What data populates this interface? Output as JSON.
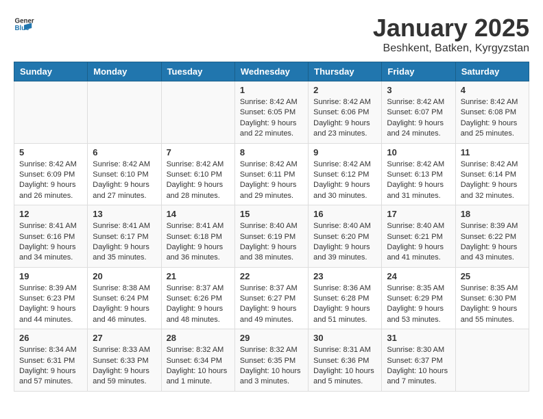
{
  "header": {
    "logo_general": "General",
    "logo_blue": "Blue",
    "month_title": "January 2025",
    "location": "Beshkent, Batken, Kyrgyzstan"
  },
  "days_of_week": [
    "Sunday",
    "Monday",
    "Tuesday",
    "Wednesday",
    "Thursday",
    "Friday",
    "Saturday"
  ],
  "weeks": [
    {
      "days": [
        {
          "num": "",
          "info": ""
        },
        {
          "num": "",
          "info": ""
        },
        {
          "num": "",
          "info": ""
        },
        {
          "num": "1",
          "info": "Sunrise: 8:42 AM\nSunset: 6:05 PM\nDaylight: 9 hours\nand 22 minutes."
        },
        {
          "num": "2",
          "info": "Sunrise: 8:42 AM\nSunset: 6:06 PM\nDaylight: 9 hours\nand 23 minutes."
        },
        {
          "num": "3",
          "info": "Sunrise: 8:42 AM\nSunset: 6:07 PM\nDaylight: 9 hours\nand 24 minutes."
        },
        {
          "num": "4",
          "info": "Sunrise: 8:42 AM\nSunset: 6:08 PM\nDaylight: 9 hours\nand 25 minutes."
        }
      ]
    },
    {
      "days": [
        {
          "num": "5",
          "info": "Sunrise: 8:42 AM\nSunset: 6:09 PM\nDaylight: 9 hours\nand 26 minutes."
        },
        {
          "num": "6",
          "info": "Sunrise: 8:42 AM\nSunset: 6:10 PM\nDaylight: 9 hours\nand 27 minutes."
        },
        {
          "num": "7",
          "info": "Sunrise: 8:42 AM\nSunset: 6:10 PM\nDaylight: 9 hours\nand 28 minutes."
        },
        {
          "num": "8",
          "info": "Sunrise: 8:42 AM\nSunset: 6:11 PM\nDaylight: 9 hours\nand 29 minutes."
        },
        {
          "num": "9",
          "info": "Sunrise: 8:42 AM\nSunset: 6:12 PM\nDaylight: 9 hours\nand 30 minutes."
        },
        {
          "num": "10",
          "info": "Sunrise: 8:42 AM\nSunset: 6:13 PM\nDaylight: 9 hours\nand 31 minutes."
        },
        {
          "num": "11",
          "info": "Sunrise: 8:42 AM\nSunset: 6:14 PM\nDaylight: 9 hours\nand 32 minutes."
        }
      ]
    },
    {
      "days": [
        {
          "num": "12",
          "info": "Sunrise: 8:41 AM\nSunset: 6:16 PM\nDaylight: 9 hours\nand 34 minutes."
        },
        {
          "num": "13",
          "info": "Sunrise: 8:41 AM\nSunset: 6:17 PM\nDaylight: 9 hours\nand 35 minutes."
        },
        {
          "num": "14",
          "info": "Sunrise: 8:41 AM\nSunset: 6:18 PM\nDaylight: 9 hours\nand 36 minutes."
        },
        {
          "num": "15",
          "info": "Sunrise: 8:40 AM\nSunset: 6:19 PM\nDaylight: 9 hours\nand 38 minutes."
        },
        {
          "num": "16",
          "info": "Sunrise: 8:40 AM\nSunset: 6:20 PM\nDaylight: 9 hours\nand 39 minutes."
        },
        {
          "num": "17",
          "info": "Sunrise: 8:40 AM\nSunset: 6:21 PM\nDaylight: 9 hours\nand 41 minutes."
        },
        {
          "num": "18",
          "info": "Sunrise: 8:39 AM\nSunset: 6:22 PM\nDaylight: 9 hours\nand 43 minutes."
        }
      ]
    },
    {
      "days": [
        {
          "num": "19",
          "info": "Sunrise: 8:39 AM\nSunset: 6:23 PM\nDaylight: 9 hours\nand 44 minutes."
        },
        {
          "num": "20",
          "info": "Sunrise: 8:38 AM\nSunset: 6:24 PM\nDaylight: 9 hours\nand 46 minutes."
        },
        {
          "num": "21",
          "info": "Sunrise: 8:37 AM\nSunset: 6:26 PM\nDaylight: 9 hours\nand 48 minutes."
        },
        {
          "num": "22",
          "info": "Sunrise: 8:37 AM\nSunset: 6:27 PM\nDaylight: 9 hours\nand 49 minutes."
        },
        {
          "num": "23",
          "info": "Sunrise: 8:36 AM\nSunset: 6:28 PM\nDaylight: 9 hours\nand 51 minutes."
        },
        {
          "num": "24",
          "info": "Sunrise: 8:35 AM\nSunset: 6:29 PM\nDaylight: 9 hours\nand 53 minutes."
        },
        {
          "num": "25",
          "info": "Sunrise: 8:35 AM\nSunset: 6:30 PM\nDaylight: 9 hours\nand 55 minutes."
        }
      ]
    },
    {
      "days": [
        {
          "num": "26",
          "info": "Sunrise: 8:34 AM\nSunset: 6:31 PM\nDaylight: 9 hours\nand 57 minutes."
        },
        {
          "num": "27",
          "info": "Sunrise: 8:33 AM\nSunset: 6:33 PM\nDaylight: 9 hours\nand 59 minutes."
        },
        {
          "num": "28",
          "info": "Sunrise: 8:32 AM\nSunset: 6:34 PM\nDaylight: 10 hours\nand 1 minute."
        },
        {
          "num": "29",
          "info": "Sunrise: 8:32 AM\nSunset: 6:35 PM\nDaylight: 10 hours\nand 3 minutes."
        },
        {
          "num": "30",
          "info": "Sunrise: 8:31 AM\nSunset: 6:36 PM\nDaylight: 10 hours\nand 5 minutes."
        },
        {
          "num": "31",
          "info": "Sunrise: 8:30 AM\nSunset: 6:37 PM\nDaylight: 10 hours\nand 7 minutes."
        },
        {
          "num": "",
          "info": ""
        }
      ]
    }
  ]
}
